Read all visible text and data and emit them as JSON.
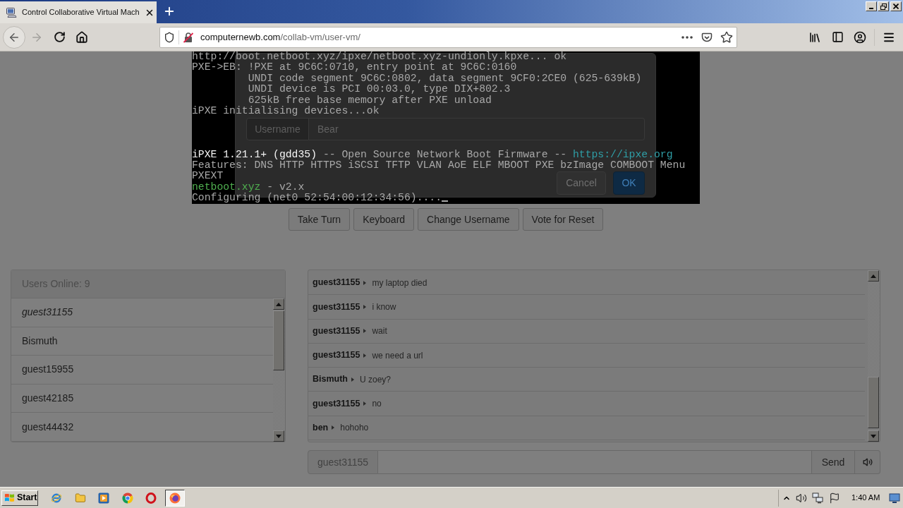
{
  "browser": {
    "tab": {
      "title": "Control Collaborative Virtual Mach",
      "selected": true
    },
    "navigation": {
      "back": {
        "disabled": false
      },
      "forward": {
        "disabled": true
      }
    },
    "url": {
      "domain": "computernewb.com",
      "path": "/collab-vm/user-vm/"
    }
  },
  "vm_screen": {
    "log": [
      {
        "segments": [
          {
            "kind": "text",
            "text": "http://boot.netboot.xyz/ipxe/netboot.xyz-undionly.kpxe... ok"
          }
        ]
      },
      {
        "segments": [
          {
            "kind": "text",
            "text": "PXE->EB: !PXE at 9C6C:0710, entry point at 9C6C:0160"
          }
        ],
        "children": [
          {
            "segments": [
              {
                "kind": "text",
                "text": "UNDI code segment 9C6C:0802, data segment 9CF0:2CE0 (625-639kB)"
              }
            ]
          },
          {
            "segments": [
              {
                "kind": "text",
                "text": "UNDI device is PCI 00:03.0, type DIX+802.3"
              }
            ]
          },
          {
            "segments": [
              {
                "kind": "text",
                "text": "625kB free base memory after PXE unload"
              }
            ]
          }
        ]
      },
      {
        "segments": [
          {
            "kind": "text",
            "text": "iPXE initialising devices...ok"
          }
        ]
      }
    ],
    "banner": [
      {
        "segments": [
          {
            "kind": "bright",
            "text": "iPXE 1.21.1+ (gdd35)"
          },
          {
            "kind": "text",
            "text": " -- Open Source Network Boot Firmware -- "
          },
          {
            "kind": "link",
            "text": "https://ipxe.org"
          }
        ]
      },
      {
        "segments": [
          {
            "kind": "text",
            "text": "Features: DNS HTTP HTTPS iSCSI TFTP VLAN AoE ELF MBOOT PXE bzImage COMBOOT Menu"
          }
        ]
      },
      {
        "segments": [
          {
            "kind": "text",
            "text": "PXEXT"
          }
        ]
      },
      {
        "segments": [
          {
            "kind": "accent",
            "text": "netboot.xyz"
          },
          {
            "kind": "text",
            "text": " - v2.x"
          }
        ]
      },
      {
        "segments": [
          {
            "kind": "text",
            "text": "Configuring (net0 52:54:00:12:34:56)...."
          }
        ]
      }
    ]
  },
  "dialog": {
    "field": {
      "label": "Username",
      "value": "Bear"
    },
    "buttons": [
      {
        "label": "Cancel",
        "kind": "secondary"
      },
      {
        "label": "OK",
        "kind": "primary"
      }
    ]
  },
  "vm_buttons": [
    "Take Turn",
    "Keyboard",
    "Change Username",
    "Vote for Reset"
  ],
  "users": {
    "heading": "Users Online: 9",
    "items": [
      {
        "name": "guest31155",
        "current": true
      },
      {
        "name": "Bismuth",
        "current": false
      },
      {
        "name": "guest15955",
        "current": false
      },
      {
        "name": "guest42185",
        "current": false
      },
      {
        "name": "guest44432",
        "current": false
      }
    ]
  },
  "chat": {
    "messages": [
      {
        "user": "guest31155",
        "text": "my laptop died"
      },
      {
        "user": "guest31155",
        "text": "i know"
      },
      {
        "user": "guest31155",
        "text": "wait"
      },
      {
        "user": "guest31155",
        "text": "we need a url"
      },
      {
        "user": "Bismuth",
        "text": "U zoey?"
      },
      {
        "user": "guest31155",
        "text": "no"
      },
      {
        "user": "ben",
        "text": "hohoho"
      }
    ],
    "input": {
      "username": "guest31155",
      "send": "Send"
    }
  },
  "taskbar": {
    "start": "Start",
    "apps": [
      {
        "kind": "ie",
        "active": false
      },
      {
        "kind": "folder",
        "active": false
      },
      {
        "kind": "media",
        "active": false
      },
      {
        "kind": "chrome",
        "active": false
      },
      {
        "kind": "opera",
        "active": false
      },
      {
        "kind": "firefox",
        "active": true
      }
    ],
    "clock": "1:40 AM"
  }
}
